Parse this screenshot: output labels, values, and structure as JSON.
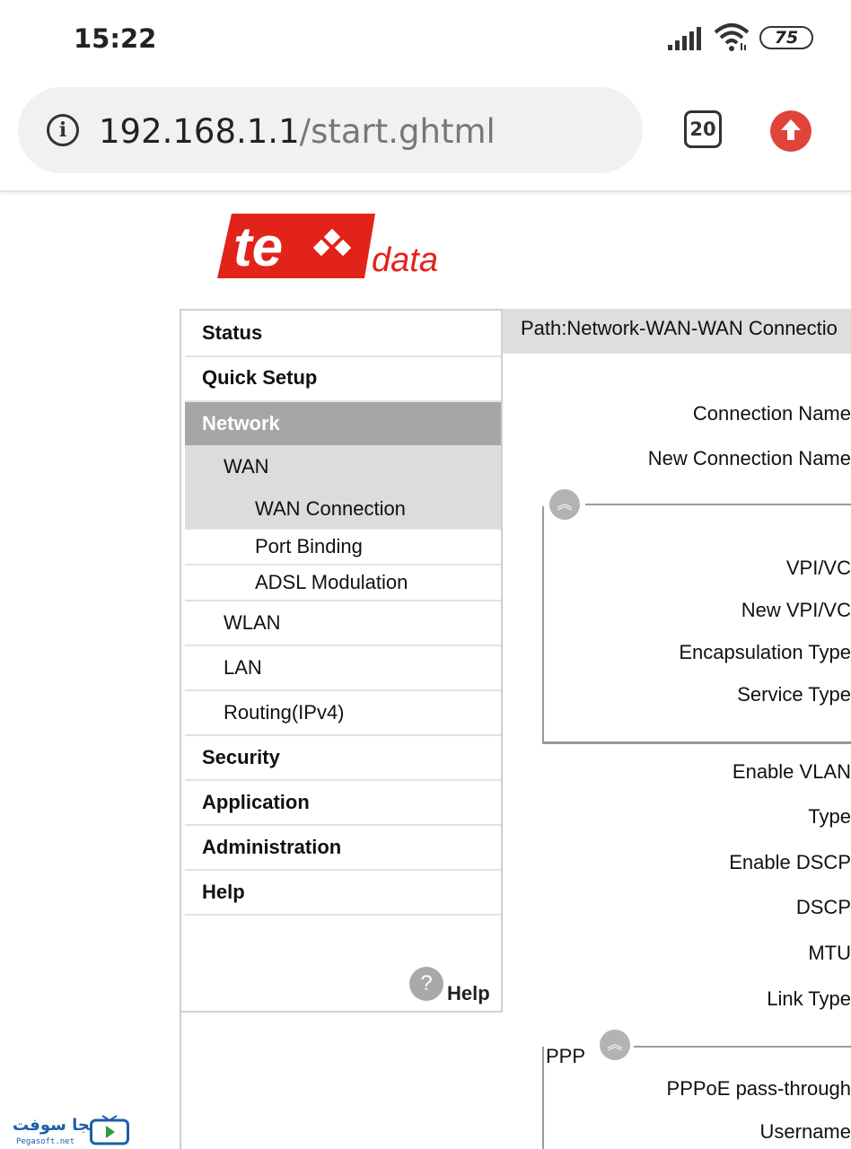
{
  "status_bar": {
    "time": "15:22",
    "battery": "75"
  },
  "browser": {
    "url_host": "192.168.1.1",
    "url_path": "/start.ghtml",
    "tab_count": "20"
  },
  "logo": {
    "text": "data",
    "mark": "te"
  },
  "sidebar": {
    "status": "Status",
    "quick_setup": "Quick Setup",
    "network": "Network",
    "wan": "WAN",
    "wan_connection": "WAN Connection",
    "port_binding": "Port Binding",
    "adsl_modulation": "ADSL Modulation",
    "wlan": "WLAN",
    "lan": "LAN",
    "routing": "Routing(IPv4)",
    "security": "Security",
    "application": "Application",
    "administration": "Administration",
    "help": "Help",
    "help_footer": "Help"
  },
  "main": {
    "path": "Path:Network-WAN-WAN Connectio",
    "connection_name": "Connection Name",
    "new_connection_name": "New Connection Name",
    "vpi_vci": "VPI/VC",
    "new_vpi_vci": "New VPI/VC",
    "encapsulation_type": "Encapsulation Type",
    "service_type": "Service Type",
    "enable_vlan": "Enable VLAN",
    "type": "Type",
    "enable_dscp": "Enable DSCP",
    "dscp": "DSCP",
    "mtu": "MTU",
    "link_type": "Link Type",
    "ppp_title": "PPP",
    "pppoe_pass_through": "PPPoE pass-through",
    "username": "Username"
  },
  "watermark": {
    "brand": "بيجا سوفت",
    "site": "Pegasoft.net"
  },
  "colors": {
    "brand_red": "#e2231a",
    "nav_active": "#a6a6a6",
    "upload_red": "#e0433a"
  }
}
